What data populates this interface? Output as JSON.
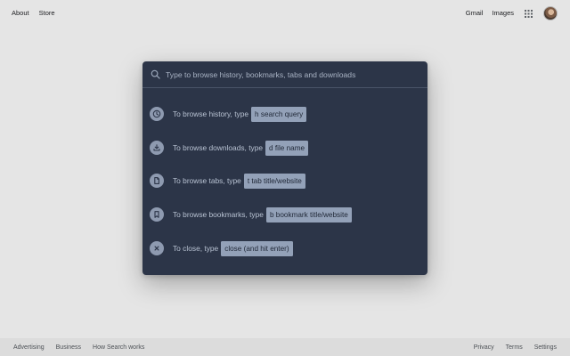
{
  "header": {
    "left_links": [
      "About",
      "Store"
    ],
    "gmail_label": "Gmail",
    "images_label": "Images",
    "icons": [
      "apps-grid-icon",
      "avatar"
    ]
  },
  "palette": {
    "search_placeholder": "Type to browse history, bookmarks, tabs and downloads",
    "search_icon": "search-icon",
    "hints": [
      {
        "icon": "clock-icon",
        "text": "To browse history, type",
        "code": "h search query"
      },
      {
        "icon": "download-icon",
        "text": "To browse downloads, type",
        "code": "d file name"
      },
      {
        "icon": "tab-icon",
        "text": "To browse tabs, type",
        "code": "t tab title/website"
      },
      {
        "icon": "bookmark-icon",
        "text": "To browse bookmarks, type",
        "code": "b bookmark title/website"
      },
      {
        "icon": "close-icon",
        "text": "To close, type",
        "code": "close (and hit enter)"
      }
    ]
  },
  "footer": {
    "left_links": [
      "Advertising",
      "Business",
      "How Search works"
    ],
    "right_links": [
      "Privacy",
      "Terms",
      "Settings"
    ]
  },
  "colors": {
    "page_background": "#e5e5e5",
    "palette_background": "#2c3548",
    "hint_code_background": "#93a1b8",
    "icon_circle": "#8e9ab0"
  }
}
